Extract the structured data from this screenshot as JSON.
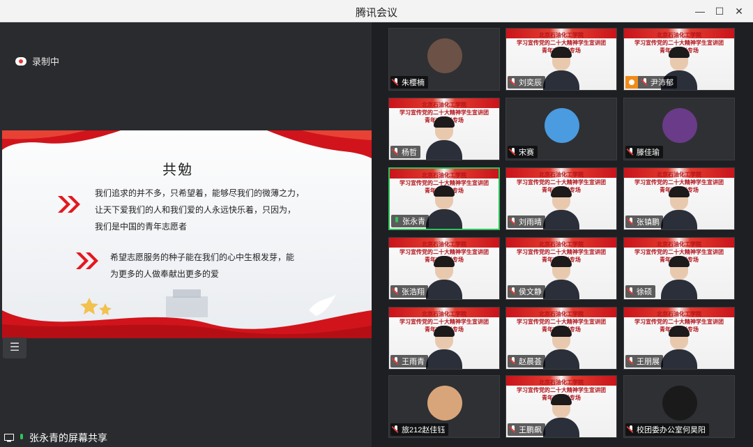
{
  "window": {
    "title": "腾讯会议",
    "minimize": "—",
    "maximize": "☐",
    "close": "✕"
  },
  "recording": {
    "label": "录制中"
  },
  "slide": {
    "title": "共勉",
    "paragraph1": [
      "我们追求的并不多，只希望着，能够尽我们的微薄之力，",
      "让天下爱我们的人和我们爱的人永远快乐着，只因为，",
      "我们是中国的青年志愿者"
    ],
    "paragraph2": [
      "希望志愿服务的种子能在我们的心中生根发芽，能",
      "为更多的人做奉献出更多的爱"
    ]
  },
  "share": {
    "label": "张永青的屏幕共享"
  },
  "banner": {
    "line1": "北京石油化工学院",
    "line2": "学习宣传党的二十大精神学生宣讲团",
    "line3": "青年志愿者专场"
  },
  "participants": [
    {
      "name": "朱樱楠",
      "type": "avatar",
      "avatar_color": "#6b5146",
      "mic": "muted"
    },
    {
      "name": "刘奕辰",
      "type": "video",
      "mic": "muted"
    },
    {
      "name": "尹沛郁",
      "type": "video",
      "mic": "muted",
      "host": true
    },
    {
      "name": "杨哲",
      "type": "video",
      "mic": "muted"
    },
    {
      "name": "宋赛",
      "type": "avatar",
      "avatar_color": "#4a9be0",
      "mic": "muted"
    },
    {
      "name": "滕佳瑜",
      "type": "avatar",
      "avatar_color": "#6a3b88",
      "mic": "muted"
    },
    {
      "name": "张永青",
      "type": "video",
      "mic": "on",
      "active": true
    },
    {
      "name": "刘雨晴",
      "type": "video",
      "mic": "muted"
    },
    {
      "name": "张镇鹏",
      "type": "video",
      "mic": "muted"
    },
    {
      "name": "张浩翔",
      "type": "video",
      "mic": "muted"
    },
    {
      "name": "侯文静",
      "type": "video",
      "mic": "muted"
    },
    {
      "name": "徐硕",
      "type": "video",
      "mic": "muted"
    },
    {
      "name": "王雨青",
      "type": "video",
      "mic": "muted"
    },
    {
      "name": "赵晨荟",
      "type": "video",
      "mic": "muted"
    },
    {
      "name": "王朋展",
      "type": "video",
      "mic": "muted"
    },
    {
      "name": "旅212赵佳钰",
      "type": "avatar",
      "avatar_color": "#d8a57a",
      "mic": "muted"
    },
    {
      "name": "王鹏飙",
      "type": "video",
      "mic": "muted"
    },
    {
      "name": "校团委办公室何昊阳",
      "type": "avatar",
      "avatar_color": "#1a1a1a",
      "mic": "muted"
    }
  ],
  "colors": {
    "accent_green": "#2ec55a",
    "mute_red": "#e53935",
    "banner_red": "#c9141b"
  }
}
